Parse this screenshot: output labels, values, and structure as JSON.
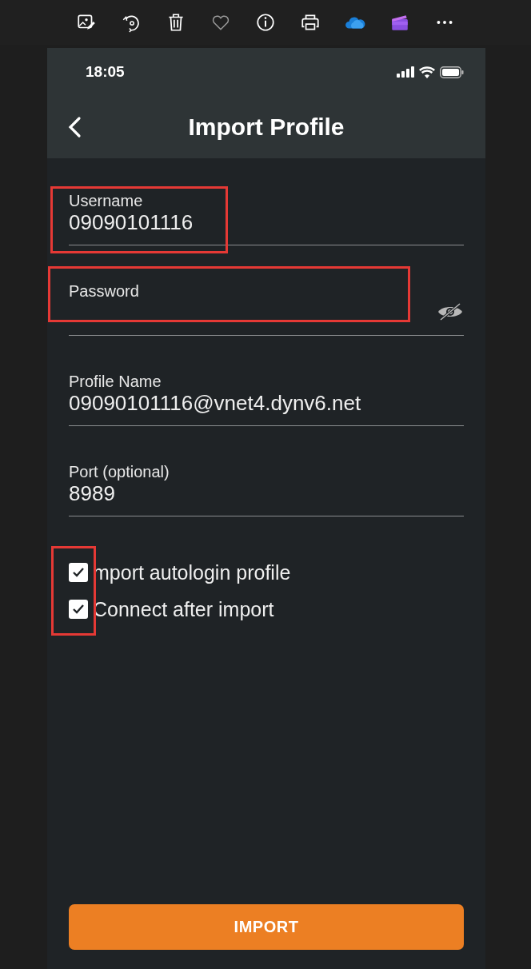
{
  "status_bar": {
    "time": "18:05"
  },
  "header": {
    "title": "Import Profile"
  },
  "fields": [
    {
      "kind": "text",
      "label": "Username",
      "value": "09090101116",
      "highlighted": true
    },
    {
      "kind": "password",
      "label": "Password",
      "highlighted": true
    },
    {
      "kind": "text",
      "label": "Profile Name",
      "value": "09090101116@vnet4.dynv6.net",
      "highlighted": false
    },
    {
      "kind": "text",
      "label": "Port (optional)",
      "value": "8989",
      "highlighted": false
    }
  ],
  "checkboxes_highlighted": true,
  "checkboxes": [
    {
      "label": "mport autologin profile",
      "checked": true
    },
    {
      "label": "Connect after import",
      "checked": true
    }
  ],
  "button": {
    "label": "IMPORT"
  }
}
